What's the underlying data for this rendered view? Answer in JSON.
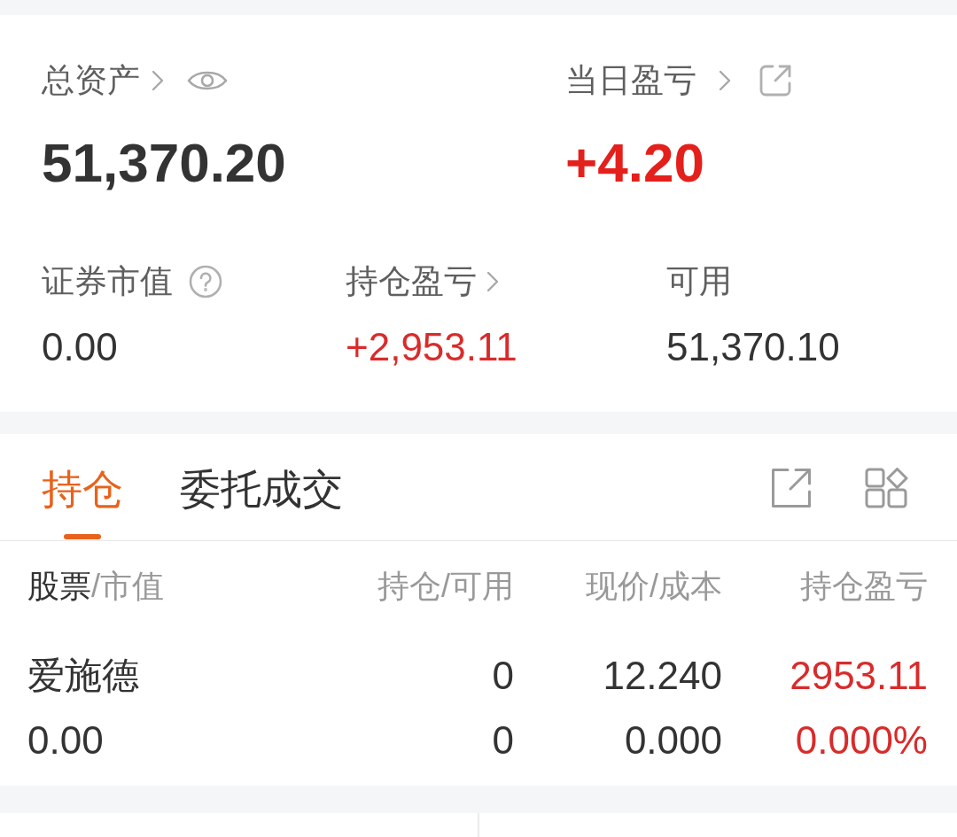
{
  "summary": {
    "rows": [
      [
        {
          "label": "总资产",
          "value": "51,370.20",
          "gain": false
        },
        {
          "label": "当日盈亏",
          "value": "+4.20",
          "gain": true
        }
      ],
      [
        {
          "label": "证券市值",
          "value": "0.00",
          "gain": false
        },
        {
          "label": "持仓盈亏",
          "value": "+2,953.11",
          "gain": true
        },
        {
          "label": "可用",
          "value": "51,370.10",
          "gain": false
        }
      ]
    ]
  },
  "tabs": [
    {
      "label": "持仓",
      "selected": true
    },
    {
      "label": "委托成交",
      "selected": false
    }
  ],
  "table": {
    "columns": [
      {
        "label": "股票",
        "sublabel": "/市值"
      },
      {
        "label": "持仓/可用"
      },
      {
        "label": "现价/成本"
      },
      {
        "label": "持仓盈亏"
      }
    ],
    "rows": [
      {
        "cells": [
          {
            "lines": [
              "爱施德",
              "0.00"
            ],
            "gain": false
          },
          {
            "lines": [
              "0",
              "0"
            ],
            "gain": false
          },
          {
            "lines": [
              "12.240",
              "0.000"
            ],
            "gain": false
          },
          {
            "lines": [
              "2953.11",
              "0.000%"
            ],
            "gain": true
          }
        ]
      }
    ]
  }
}
